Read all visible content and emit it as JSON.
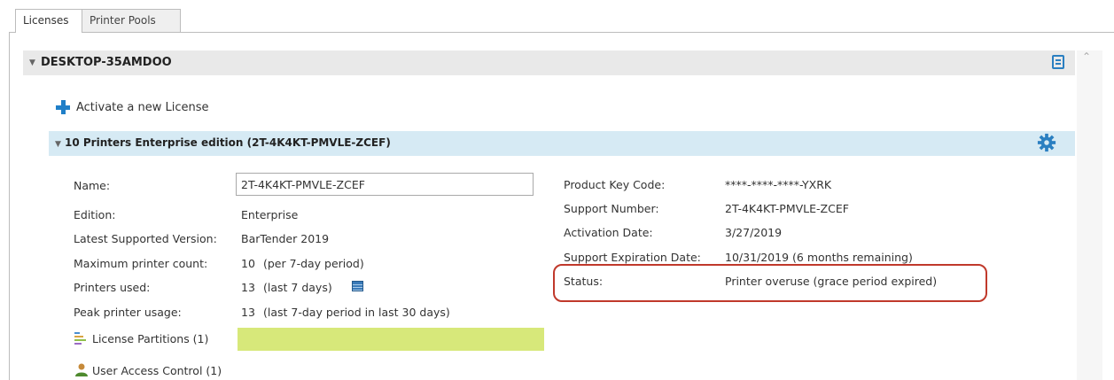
{
  "tabs": [
    {
      "label": "Licenses",
      "active": true
    },
    {
      "label": "Printer Pools",
      "active": false
    }
  ],
  "machine": {
    "name": "DESKTOP-35AMDOO",
    "collapse_icon": "chevron-down-icon",
    "menu_icon": "list-view-icon"
  },
  "activate_link": "Activate a new License",
  "license": {
    "title": "10 Printers Enterprise edition (2T-4K4KT-PMVLE-ZCEF)",
    "settings_icon": "gear-icon",
    "left_fields": [
      {
        "label": "Name:",
        "value": "2T-4K4KT-PMVLE-ZCEF"
      },
      {
        "label": "Edition:",
        "value": "Enterprise"
      },
      {
        "label": "Latest Supported Version:",
        "value": "BarTender 2019"
      },
      {
        "label": "Maximum printer count:",
        "value": "10",
        "note": "(per 7-day period)"
      },
      {
        "label": "Printers used:",
        "value": "13",
        "note": "(last 7 days)"
      },
      {
        "label": "Peak printer usage:",
        "value": "13",
        "note": "(last 7-day period in last 30 days)"
      }
    ],
    "right_fields": [
      {
        "label": "Product Key Code:",
        "value": "****-****-****-YXRK"
      },
      {
        "label": "Support Number:",
        "value": "2T-4K4KT-PMVLE-ZCEF"
      },
      {
        "label": "Activation Date:",
        "value": "3/27/2019"
      },
      {
        "label": "Support Expiration Date:",
        "value": "10/31/2019 (6 months remaining)"
      },
      {
        "label": "Status:",
        "value": "Printer overuse (grace period expired)"
      }
    ],
    "partitions_label": "License Partitions (1)",
    "user_access_label": "User Access Control (1)"
  },
  "colors": {
    "accent_blue": "#1f7fc8",
    "license_header_bg": "#d6eaf4",
    "partition_bar": "#d7e87a",
    "status_highlight": "#c0392b"
  }
}
